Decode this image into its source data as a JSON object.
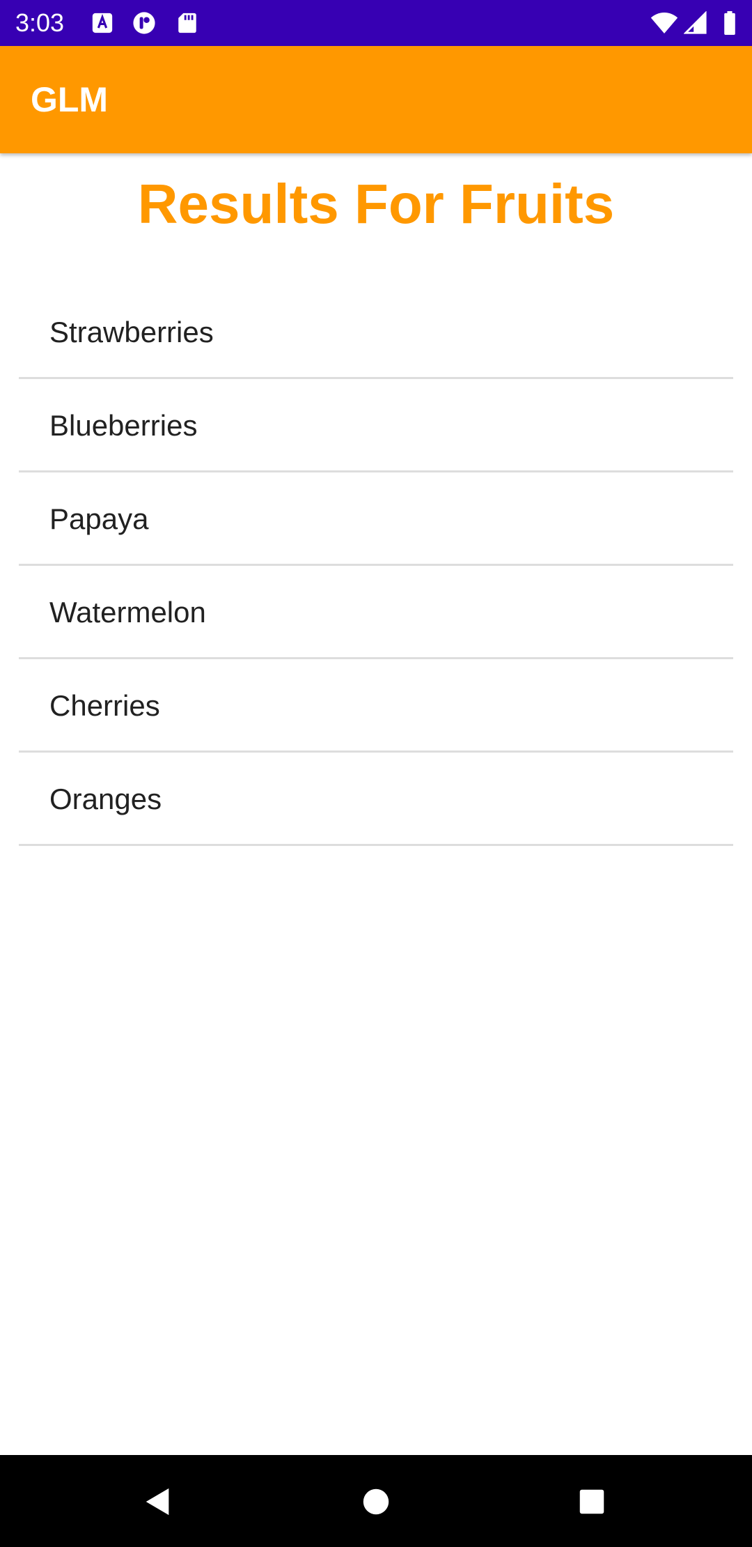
{
  "status_bar": {
    "time": "3:03",
    "background": "#3700b3",
    "left_icons": [
      "keyboard-a-icon",
      "t-app-icon",
      "sd-card-icon"
    ],
    "right_icons": [
      "wifi-icon",
      "cell-signal-icon",
      "battery-icon"
    ]
  },
  "app_bar": {
    "title": "GLM",
    "background": "#ff9800"
  },
  "page": {
    "heading": "Results For Fruits",
    "heading_color": "#ff9800"
  },
  "results": {
    "items": [
      {
        "label": "Strawberries"
      },
      {
        "label": "Blueberries"
      },
      {
        "label": "Papaya"
      },
      {
        "label": "Watermelon"
      },
      {
        "label": "Cherries"
      },
      {
        "label": "Oranges"
      }
    ]
  },
  "nav_bar": {
    "buttons": [
      "back-icon",
      "home-icon",
      "recents-icon"
    ]
  }
}
